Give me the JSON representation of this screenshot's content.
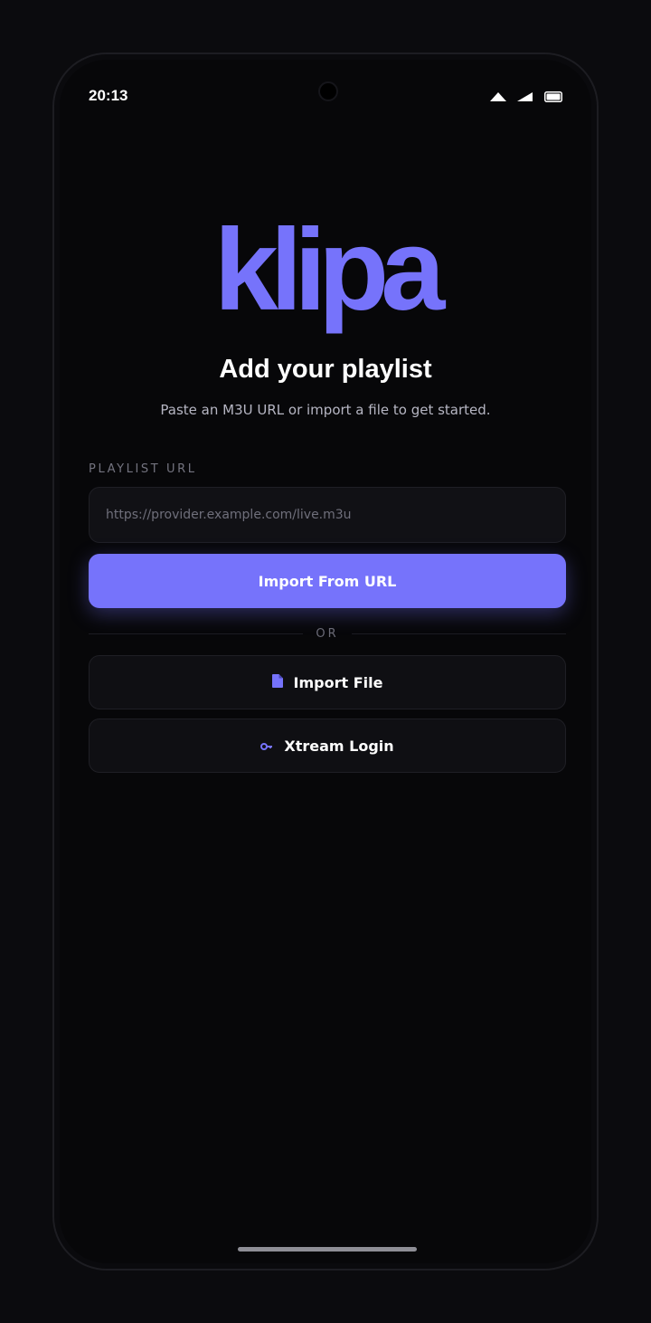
{
  "status_bar": {
    "time": "20:13",
    "icons": [
      "wifi-icon",
      "signal-icon",
      "battery-icon"
    ]
  },
  "brand": {
    "logo_text": "klipa",
    "accent_color": "#7673fb"
  },
  "onboarding": {
    "title": "Add your playlist",
    "subtitle": "Paste an M3U URL or import a file to get started."
  },
  "url_form": {
    "label": "PLAYLIST URL",
    "placeholder": "https://provider.example.com/live.m3u",
    "value": "",
    "submit_label": "Import From URL"
  },
  "divider_text": "OR",
  "alt_actions": {
    "import_file": {
      "label": "Import File",
      "icon": "file-icon"
    },
    "xtream_login": {
      "label": "Xtream Login",
      "icon": "key-icon"
    }
  }
}
